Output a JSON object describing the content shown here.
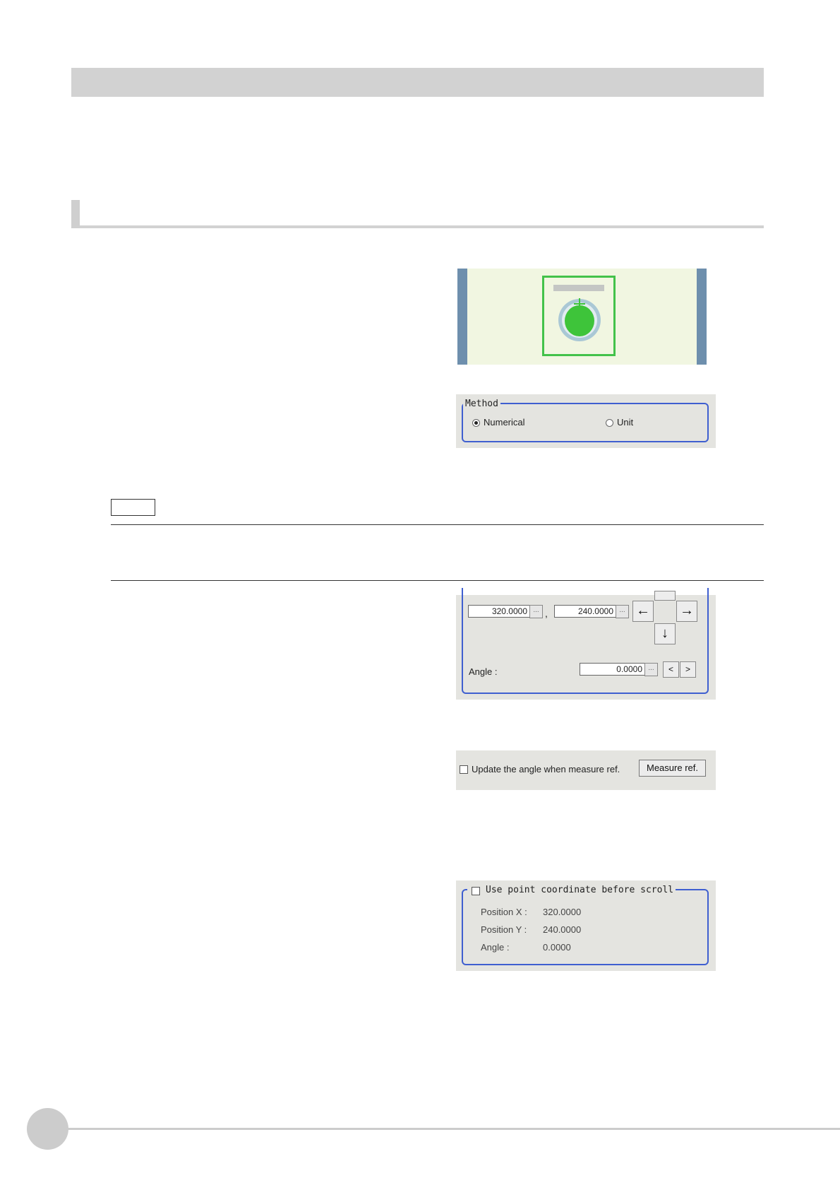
{
  "method_panel": {
    "legend": "Method",
    "options": [
      {
        "label": "Numerical",
        "selected": true
      },
      {
        "label": "Unit",
        "selected": false
      }
    ]
  },
  "position_panel": {
    "x_value": "320.0000",
    "y_value": "240.0000",
    "separator": ",",
    "ellipsis": "...",
    "arrows": {
      "left": "←",
      "right": "→",
      "down": "↓"
    },
    "angle_label": "Angle :",
    "angle_value": "0.0000",
    "angle_dec": "<",
    "angle_inc": ">"
  },
  "measure_panel": {
    "checkbox_label": "Update the angle when measure ref.",
    "checked": false,
    "button_label": "Measure ref."
  },
  "scroll_panel": {
    "legend": "Use point coordinate before scroll",
    "checked": false,
    "rows": [
      {
        "label": "Position X :",
        "value": "320.0000"
      },
      {
        "label": "Position Y :",
        "value": "240.0000"
      },
      {
        "label": "Angle :",
        "value": "0.0000"
      }
    ]
  },
  "colors": {
    "fieldset_border": "#3f5fd0",
    "panel_bg": "#e4e4e0",
    "target_green": "#3ec43a",
    "image_bg": "#f1f6e1",
    "scroll_bar": "#6e8fad"
  }
}
